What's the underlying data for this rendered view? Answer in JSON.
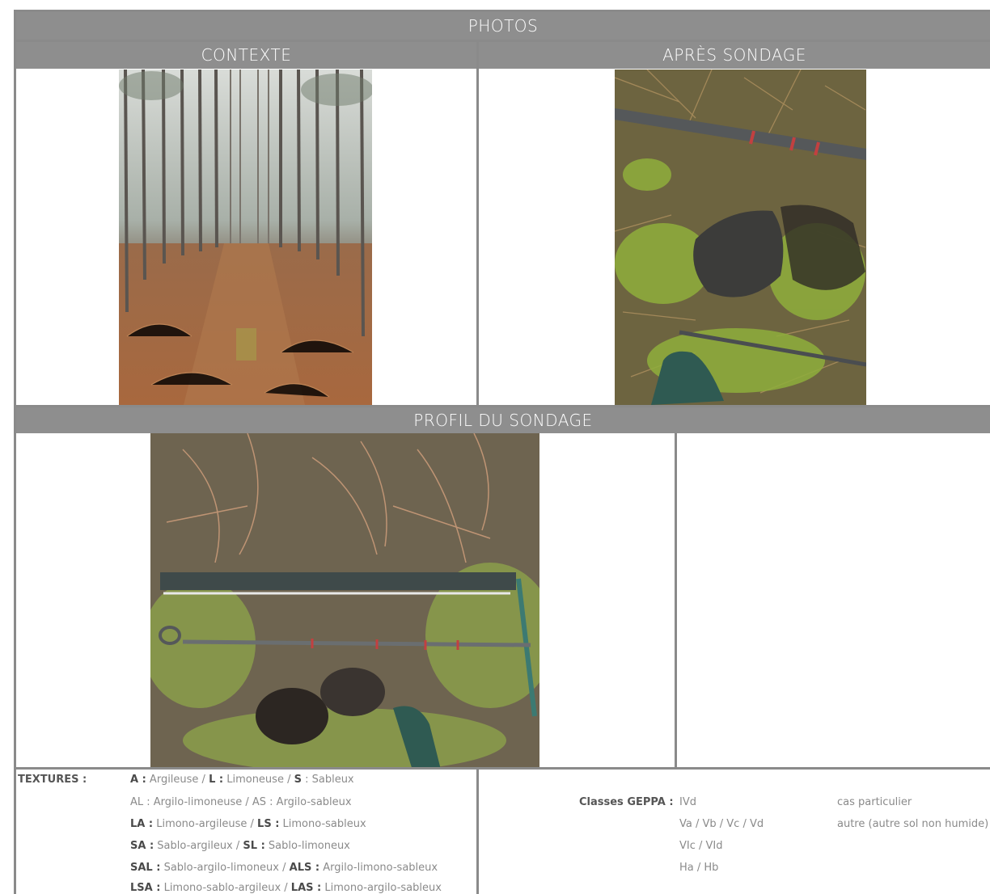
{
  "header": {
    "photos": "PHOTOS",
    "contexte": "CONTEXTE",
    "apres_sondage": "APRÈS SONDAGE",
    "profil": "PROFIL DU SONDAGE"
  },
  "textures": {
    "label": "TEXTURES :",
    "lines": [
      [
        {
          "b": "A :",
          "t": " Argileuse / "
        },
        {
          "b": "L :",
          "t": " Limoneuse / "
        },
        {
          "b": "S",
          "t": " : Sableux"
        }
      ],
      [
        {
          "b": "",
          "t": "AL : Argilo-limoneuse / AS : Argilo-sableux"
        }
      ],
      [
        {
          "b": "LA :",
          "t": " Limono-argileuse / "
        },
        {
          "b": "LS :",
          "t": " Limono-sableux"
        }
      ],
      [
        {
          "b": "SA :",
          "t": " Sablo-argileux / "
        },
        {
          "b": "SL :",
          "t": " Sablo-limoneux"
        }
      ],
      [
        {
          "b": "SAL :",
          "t": " Sablo-argilo-limoneux  / "
        },
        {
          "b": "ALS :",
          "t": " Argilo-limono-sableux"
        }
      ],
      [
        {
          "b": "LSA :",
          "t": " Limono-sablo-argileux /  "
        },
        {
          "b": "LAS :",
          "t": " Limono-argilo-sableux"
        }
      ]
    ]
  },
  "geppa": {
    "label": "Classes GEPPA :",
    "classes": [
      "IVd",
      "Va / Vb / Vc / Vd",
      "VIc / VId",
      "Ha / Hb"
    ],
    "notes": [
      "cas particulier",
      "autre (autre sol non humide)"
    ]
  }
}
